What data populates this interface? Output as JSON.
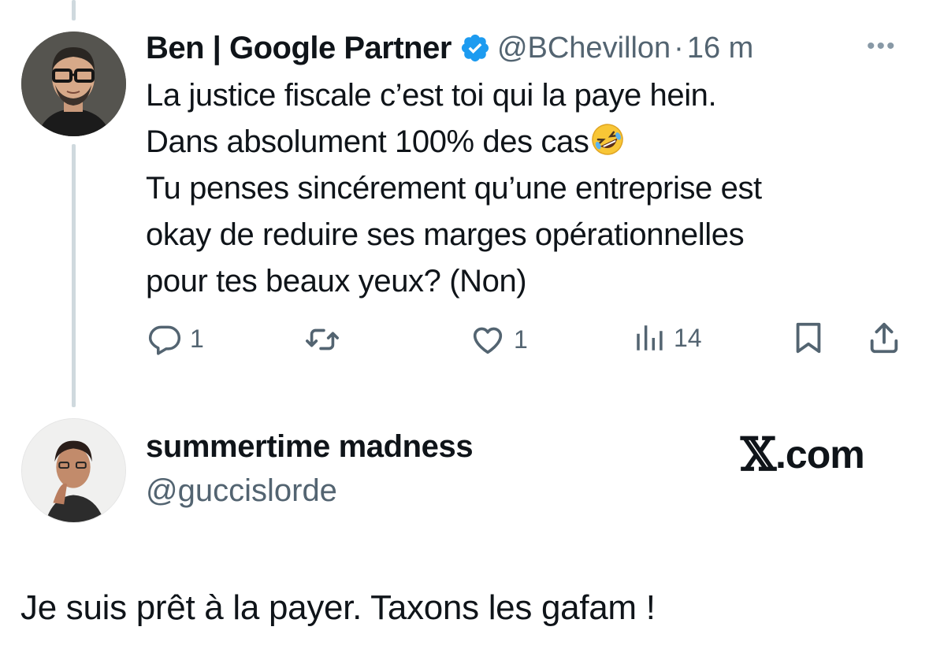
{
  "tweet": {
    "display_name": "Ben | Google Partner",
    "handle": "@BChevillon",
    "separator": "·",
    "time": "16 m",
    "more": "•••",
    "body_lines": [
      "La justice fiscale c’est toi qui la paye hein.",
      "Dans absolument 100% des cas",
      "Tu penses sincérement qu’une entreprise est",
      "okay de reduire ses marges opérationnelles",
      "pour tes beaux yeux? (Non)"
    ],
    "actions": {
      "reply_count": "1",
      "like_count": "1",
      "views_count": "14"
    },
    "icons": {
      "verified": "verified-badge-icon",
      "emoji": "rolling-on-floor-laughing-emoji",
      "reply": "reply-icon",
      "retweet": "retweet-icon",
      "like": "heart-icon",
      "views": "views-icon",
      "bookmark": "bookmark-icon",
      "share": "share-icon"
    }
  },
  "quote": {
    "display_name": "summertime madness",
    "handle": "@guccislorde",
    "brand_x": "𝕏",
    "brand_suffix": ".com",
    "reply_text": "Je suis prêt à la payer. Taxons les gafam !"
  },
  "colors": {
    "text": "#0f1419",
    "secondary": "#536471",
    "verified": "#1d9bf0",
    "thread_line": "#cfd9de"
  }
}
